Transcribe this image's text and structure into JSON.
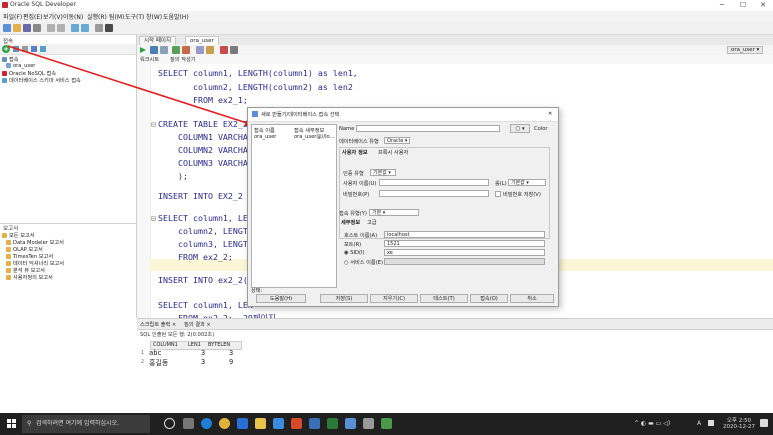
{
  "window": {
    "title": "Oracle SQL Developer",
    "min": "─",
    "max": "☐",
    "close": "✕"
  },
  "menu": [
    "파일(F)",
    "편집(E)",
    "보기(V)",
    "이동(N)",
    "실행(R)",
    "팀(M)",
    "도구(T)",
    "창(W)",
    "도움말(H)"
  ],
  "connections_panel": {
    "title": "접속",
    "items": [
      "접속",
      "ora_user",
      "Oracle NoSQL 접속",
      "데이터베이스 스키마 서비스 접속"
    ]
  },
  "reports_panel": {
    "title": "보고서",
    "items": [
      "모든 보고서",
      "Data Modeler 보고서",
      "OLAP 보고서",
      "TimesTen 보고서",
      "데이터 딕셔너리 보고서",
      "분석 뷰 보고서",
      "사용자정의 보고서"
    ]
  },
  "editor": {
    "tabs": [
      "시작 페이지",
      "ora_user"
    ],
    "subtabs": [
      "워크시트",
      "질의 작성기"
    ],
    "connection_selector": "ora_user ▾",
    "code_lines": [
      "SELECT column1, LENGTH(column1) as len1,",
      "       column2, LENGTH(column2) as len2",
      "       FROM ex2_1;",
      "",
      "CREATE TABLE EX2_2 (",
      "    COLUMN1 VARCHAR",
      "    COLUMN2 VARCHAR",
      "    COLUMN3 VARCHAR",
      "    );",
      "",
      "INSERT INTO EX2_2 V",
      "",
      "SELECT column1, LEN",
      "    column2, LENGTH",
      "    column3, LENGTH",
      "    FROM ex2_2;",
      "",
      "INSERT INTO ex2_2(c",
      "",
      "SELECT column1, LEN",
      "    FROM ex2_2;  29페이지"
    ]
  },
  "dialog": {
    "title": "새로 만들기/데이터베이스 접속 선택",
    "col_name": "접속 이름",
    "col_detail": "접속 세부정보",
    "conn_name": "ora_user",
    "conn_detail": "ora_user@//lo...",
    "name_label": "Name",
    "color_label": "Color",
    "db_type_label": "데이터베이스 유형",
    "db_type_value": "Oracle ▾",
    "tabs": [
      "사용자 정보",
      "프록시 사용자"
    ],
    "auth_type_label": "인증 유형",
    "auth_type_value": "기본값 ▾",
    "username_label": "사용자 이름(U)",
    "role_label": "롤(L)",
    "role_value": "기본값",
    "password_label": "비밀번호(P)",
    "save_password_label": "비밀번호 저장(V)",
    "conn_type_label": "접속 유형(Y)",
    "conn_type_value": "기본 ▾",
    "detail_tabs": [
      "세부정보",
      "고급"
    ],
    "host_label": "호스트 이름(A)",
    "host_value": "localhost",
    "port_label": "포트(R)",
    "port_value": "1521",
    "sid_label": "SID(I)",
    "sid_value": "xe",
    "service_label": "서비스 이름(E)",
    "status_label": "상태:",
    "buttons": {
      "help": "도움말(H)",
      "save": "저장(S)",
      "clear": "지우기(C)",
      "test": "테스트(T)",
      "connect": "접속(O)",
      "cancel": "취소"
    }
  },
  "bottom": {
    "tabs": [
      "스크립트 출력 ×",
      "질의 결과 ×"
    ],
    "status": "SQL  인출된 모든 행: 2(0.002초)",
    "headers": [
      "COLUMN1",
      "LEN1",
      "BYTELEN"
    ],
    "rows": [
      [
        "1",
        "abc",
        "3",
        "3"
      ],
      [
        "2",
        "홍길동",
        "3",
        "9"
      ]
    ]
  },
  "taskbar": {
    "search_placeholder": "검색하려면 여기에 입력하십시오.",
    "time": "오후 2:50",
    "date": "2020-12-27",
    "ime": "A"
  }
}
